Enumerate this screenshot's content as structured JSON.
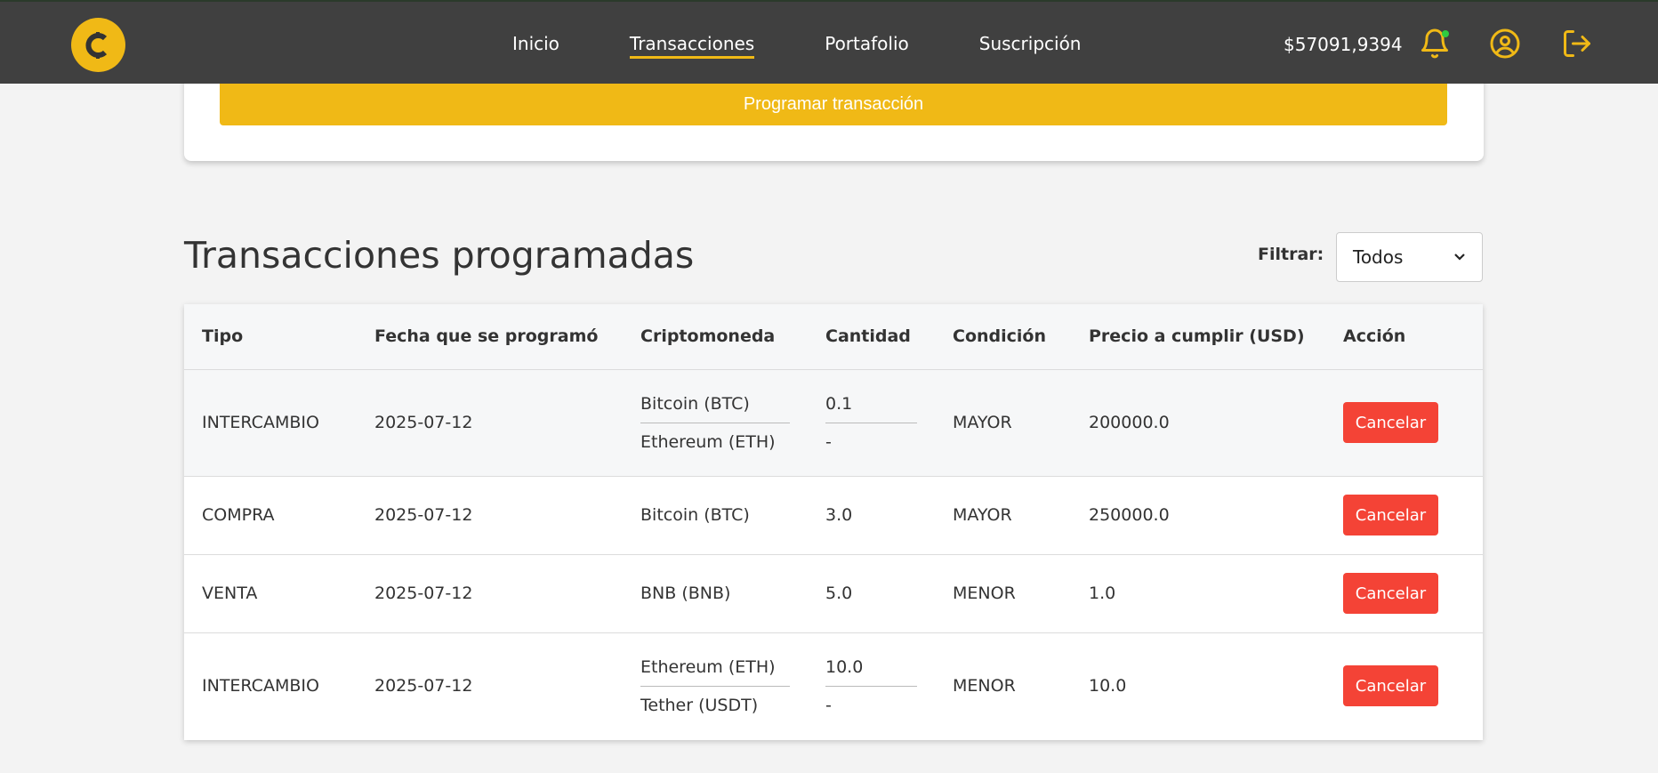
{
  "nav": {
    "links": [
      "Inicio",
      "Transacciones",
      "Portafolio",
      "Suscripción"
    ],
    "active": "Transacciones",
    "balance": "$57091,9394"
  },
  "colors": {
    "accent": "#f0b916",
    "navbar": "#404040",
    "danger": "#f44336",
    "notification_dot": "#2ecc40"
  },
  "icons": {
    "logo": "coin-logo-icon",
    "bell": "bell-icon",
    "user": "user-circle-icon",
    "logout": "logout-icon"
  },
  "top_card": {
    "button_label": "Programar transacción"
  },
  "section": {
    "title": "Transacciones programadas",
    "filter_label": "Filtrar:",
    "filter_value": "Todos"
  },
  "table": {
    "headers": [
      "Tipo",
      "Fecha que se programó",
      "Criptomoneda",
      "Cantidad",
      "Condición",
      "Precio a cumplir (USD)",
      "Acción"
    ],
    "rows": [
      {
        "tipo": "INTERCAMBIO",
        "fecha": "2025-07-12",
        "cripto": [
          "Bitcoin (BTC)",
          "Ethereum (ETH)"
        ],
        "cantidad": [
          "0.1",
          "-"
        ],
        "condicion": "MAYOR",
        "precio": "200000.0",
        "accion": "Cancelar"
      },
      {
        "tipo": "COMPRA",
        "fecha": "2025-07-12",
        "cripto": [
          "Bitcoin (BTC)"
        ],
        "cantidad": [
          "3.0"
        ],
        "condicion": "MAYOR",
        "precio": "250000.0",
        "accion": "Cancelar"
      },
      {
        "tipo": "VENTA",
        "fecha": "2025-07-12",
        "cripto": [
          "BNB (BNB)"
        ],
        "cantidad": [
          "5.0"
        ],
        "condicion": "MENOR",
        "precio": "1.0",
        "accion": "Cancelar"
      },
      {
        "tipo": "INTERCAMBIO",
        "fecha": "2025-07-12",
        "cripto": [
          "Ethereum (ETH)",
          "Tether (USDT)"
        ],
        "cantidad": [
          "10.0",
          "-"
        ],
        "condicion": "MENOR",
        "precio": "10.0",
        "accion": "Cancelar"
      }
    ]
  }
}
